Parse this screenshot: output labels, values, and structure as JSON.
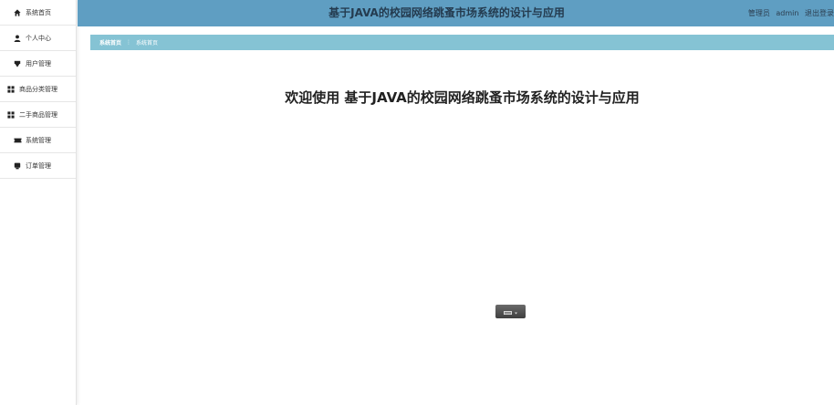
{
  "sidebar": {
    "items": [
      {
        "label": "系统首页",
        "icon": "home-icon"
      },
      {
        "label": "个人中心",
        "icon": "user-icon"
      },
      {
        "label": "用户管理",
        "icon": "shield-icon"
      },
      {
        "label": "商品分类管理",
        "icon": "grid-icon"
      },
      {
        "label": "二手商品管理",
        "icon": "grid-icon"
      },
      {
        "label": "系统管理",
        "icon": "ticket-icon"
      },
      {
        "label": "订单管理",
        "icon": "order-icon"
      }
    ]
  },
  "header": {
    "title": "基于JAVA的校园网络跳蚤市场系统的设计与应用",
    "role": "管理员",
    "username": "admin",
    "logout": "退出登录"
  },
  "breadcrumb": {
    "root": "系统首页",
    "current": "系统首页"
  },
  "main": {
    "welcome": "欢迎使用 基于JAVA的校园网络跳蚤市场系统的设计与应用"
  },
  "colors": {
    "header_bg": "#5f9ec2",
    "breadcrumb_bg": "#85c3d4",
    "sidebar_bg": "#ffffff"
  }
}
